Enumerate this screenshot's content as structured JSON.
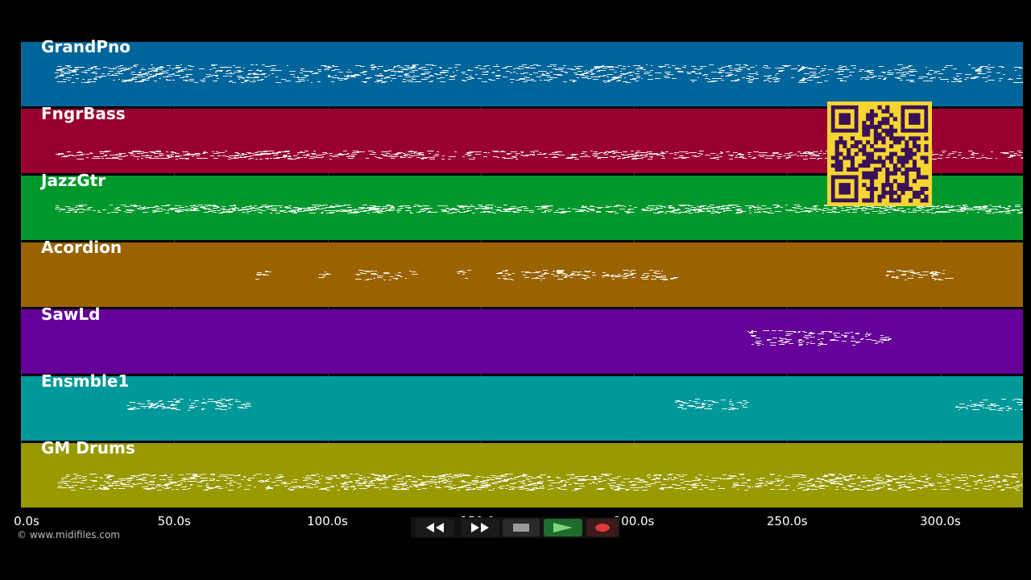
{
  "copyright": "© www.midifiles.com",
  "colors": {
    "background": "#000000",
    "note": "#ffffff",
    "qr_fg": "#3a1156",
    "qr_bg": "#f5d531"
  },
  "tracks": [
    {
      "name": "GrandPno",
      "color": "#00659a"
    },
    {
      "name": "FngrBass",
      "color": "#990030"
    },
    {
      "name": "JazzGtr",
      "color": "#00982c"
    },
    {
      "name": "Acordion",
      "color": "#9a6300"
    },
    {
      "name": "SawLd",
      "color": "#650098"
    },
    {
      "name": "Ensmble1",
      "color": "#009999"
    },
    {
      "name": "GM Drums",
      "color": "#999900"
    }
  ],
  "timeline": {
    "unit": "s",
    "visible_range_s": [
      0,
      327
    ],
    "ticks": [
      "0.0s",
      "50.0s",
      "100.0s",
      "150.0s",
      "200.0s",
      "250.0s",
      "300.0s"
    ],
    "tick_values_s": [
      0,
      50,
      100,
      150,
      200,
      250,
      300
    ]
  },
  "transport": {
    "buttons": [
      {
        "name": "rewind-button",
        "icon": "rewind-icon",
        "color": "#1a1a1a"
      },
      {
        "name": "fast-forward-button",
        "icon": "fast-forward-icon",
        "color": "#1a1a1a"
      },
      {
        "name": "stop-button",
        "icon": "stop-icon",
        "color": "#2a2a2a"
      },
      {
        "name": "play-button",
        "icon": "play-icon",
        "color": "#1f6b2e"
      },
      {
        "name": "record-button",
        "icon": "record-icon",
        "color": "#3a1a1a"
      }
    ]
  },
  "qr_code": {
    "icon": "qr-code-icon"
  }
}
